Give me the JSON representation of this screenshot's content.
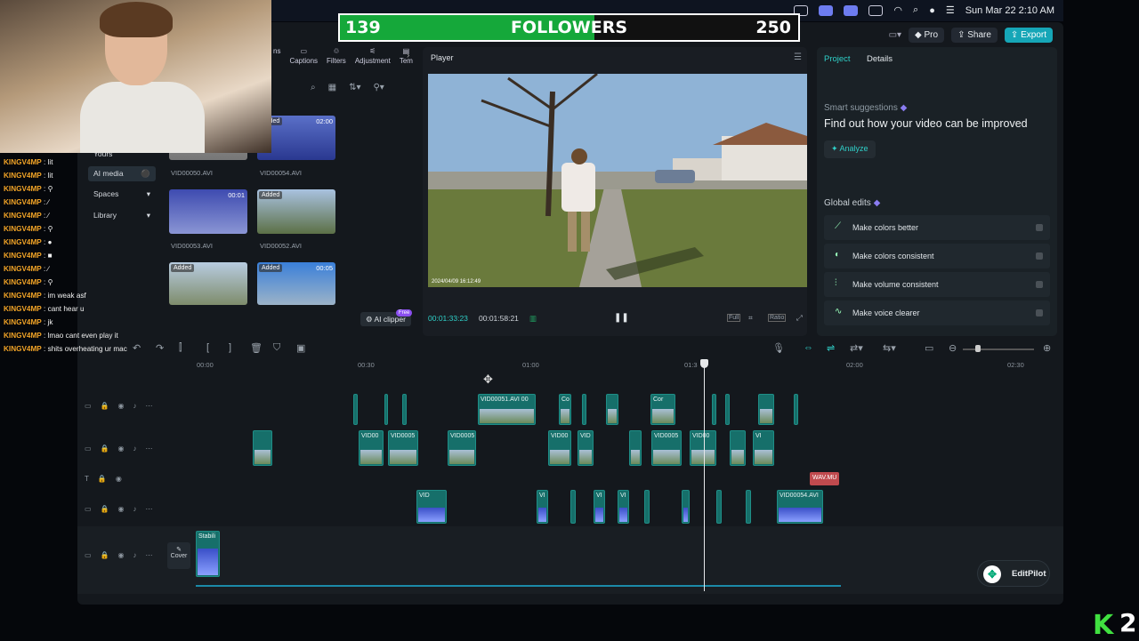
{
  "followers": {
    "current": "139",
    "label": "FOLLOWERS",
    "goal": "250",
    "progress": 0.556
  },
  "menubar": {
    "datetime": "Sun Mar 22  2:10 AM"
  },
  "toolbar": {
    "pro": "Pro",
    "share": "Share",
    "export": "Export"
  },
  "media": {
    "tabs": [
      "ns",
      "Captions",
      "Filters",
      "Adjustment",
      "Tem"
    ],
    "sidebar": [
      "Yours",
      "AI media",
      "Spaces",
      "Library"
    ],
    "thumbs": [
      {
        "name": "VID00050.AVI",
        "tag": "",
        "dur": ""
      },
      {
        "name": "VID00054.AVI",
        "tag": "Added",
        "dur": "02:00"
      },
      {
        "name": "VID00053.AVI",
        "tag": "",
        "dur": "00:01"
      },
      {
        "name": "VID00052.AVI",
        "tag": "Added",
        "dur": ""
      },
      {
        "name": "",
        "tag": "Added",
        "dur": ""
      },
      {
        "name": "",
        "tag": "Added",
        "dur": "00:05"
      }
    ],
    "ai_clipper": "AI clipper",
    "free": "Free"
  },
  "player": {
    "title": "Player",
    "timestamp": "2024/04/09  16:12:49",
    "current": "00:01:33:23",
    "total": "00:01:58:21",
    "btn_full": "Full",
    "btn_ratio": "Ratio"
  },
  "rpanel": {
    "tabs": [
      "Project",
      "Details"
    ],
    "smart_title": "Smart suggestions",
    "smart_heading": "Find out how your video can be improved",
    "analyze": "Analyze",
    "global_title": "Global edits",
    "edits": [
      "Make colors better",
      "Make colors consistent",
      "Make volume consistent",
      "Make voice clearer"
    ]
  },
  "ruler": [
    "00:00",
    "00:30",
    "01:00",
    "01:3",
    "02:00",
    "02:30"
  ],
  "tracks": {
    "cover": "Cover",
    "stabilize": "Stabili",
    "audio_label": "WAV.MU",
    "clip_labels": [
      "VID00051.AVI",
      "00",
      "Co",
      "Cor",
      "VID00",
      "VID0005",
      "VID0005",
      "VID00",
      "VID",
      "VID0005",
      "VID00",
      "VI",
      "VI",
      "VID",
      "VID",
      "VI",
      "VI",
      "VI",
      "VID00054.AVI"
    ]
  },
  "editpilot": "EditPilot",
  "chat": [
    {
      "user": "KINGV4MP",
      "msg": "lit"
    },
    {
      "user": "KINGV4MP",
      "msg": "lit"
    },
    {
      "user": "KINGV4MP",
      "msg": "⚲"
    },
    {
      "user": "KINGV4MP",
      "msg": "∕"
    },
    {
      "user": "KINGV4MP",
      "msg": "∕"
    },
    {
      "user": "KINGV4MP",
      "msg": "⚲"
    },
    {
      "user": "KINGV4MP",
      "msg": "●"
    },
    {
      "user": "KINGV4MP",
      "msg": "■"
    },
    {
      "user": "KINGV4MP",
      "msg": "∕"
    },
    {
      "user": "KINGV4MP",
      "msg": "⚲"
    },
    {
      "user": "KINGV4MP",
      "msg": "im weak asf"
    },
    {
      "user": "KINGV4MP",
      "msg": "cant hear u"
    },
    {
      "user": "KINGV4MP",
      "msg": "jk"
    },
    {
      "user": "KINGV4MP",
      "msg": "lmao cant even play it"
    },
    {
      "user": "KINGV4MP",
      "msg": "shits overheating ur mac"
    }
  ],
  "stream_logo": "K",
  "stream_num": "2",
  "colors": {
    "green": "#15a83a",
    "accent": "#16a6b7",
    "clip": "#166f6a",
    "chat_user": "#f2a427"
  }
}
